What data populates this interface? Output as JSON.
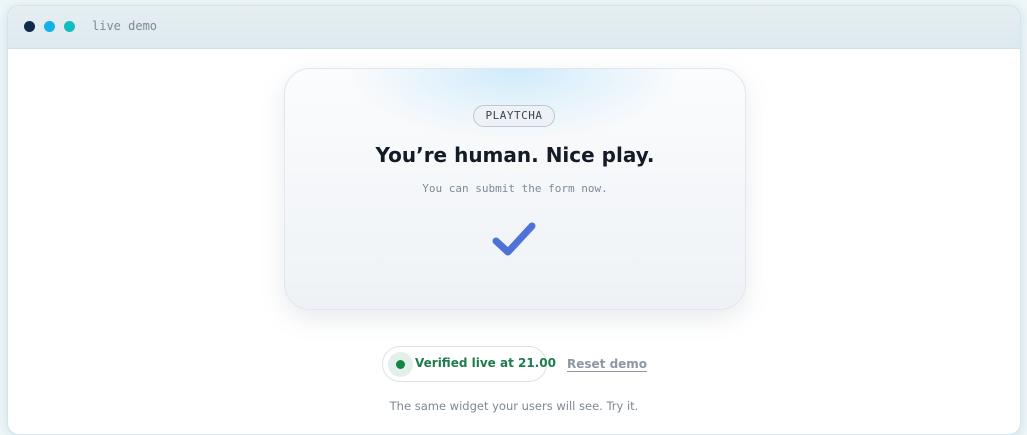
{
  "window": {
    "title": "live demo",
    "dot_colors": [
      "#0f2a4a",
      "#10b2e8",
      "#12bcc0"
    ]
  },
  "card": {
    "badge": "PLAYTCHA",
    "headline": "You’re human. Nice play.",
    "subtext": "You can submit the form now.",
    "check_icon": "checkmark-icon",
    "check_color": "#4f72d6"
  },
  "status": {
    "label": "Verified live at 21.00",
    "color": "#1f7a4c",
    "dot_color": "#128546"
  },
  "reset": {
    "label": "Reset demo"
  },
  "footnote": "The same widget your users will see. Try it."
}
